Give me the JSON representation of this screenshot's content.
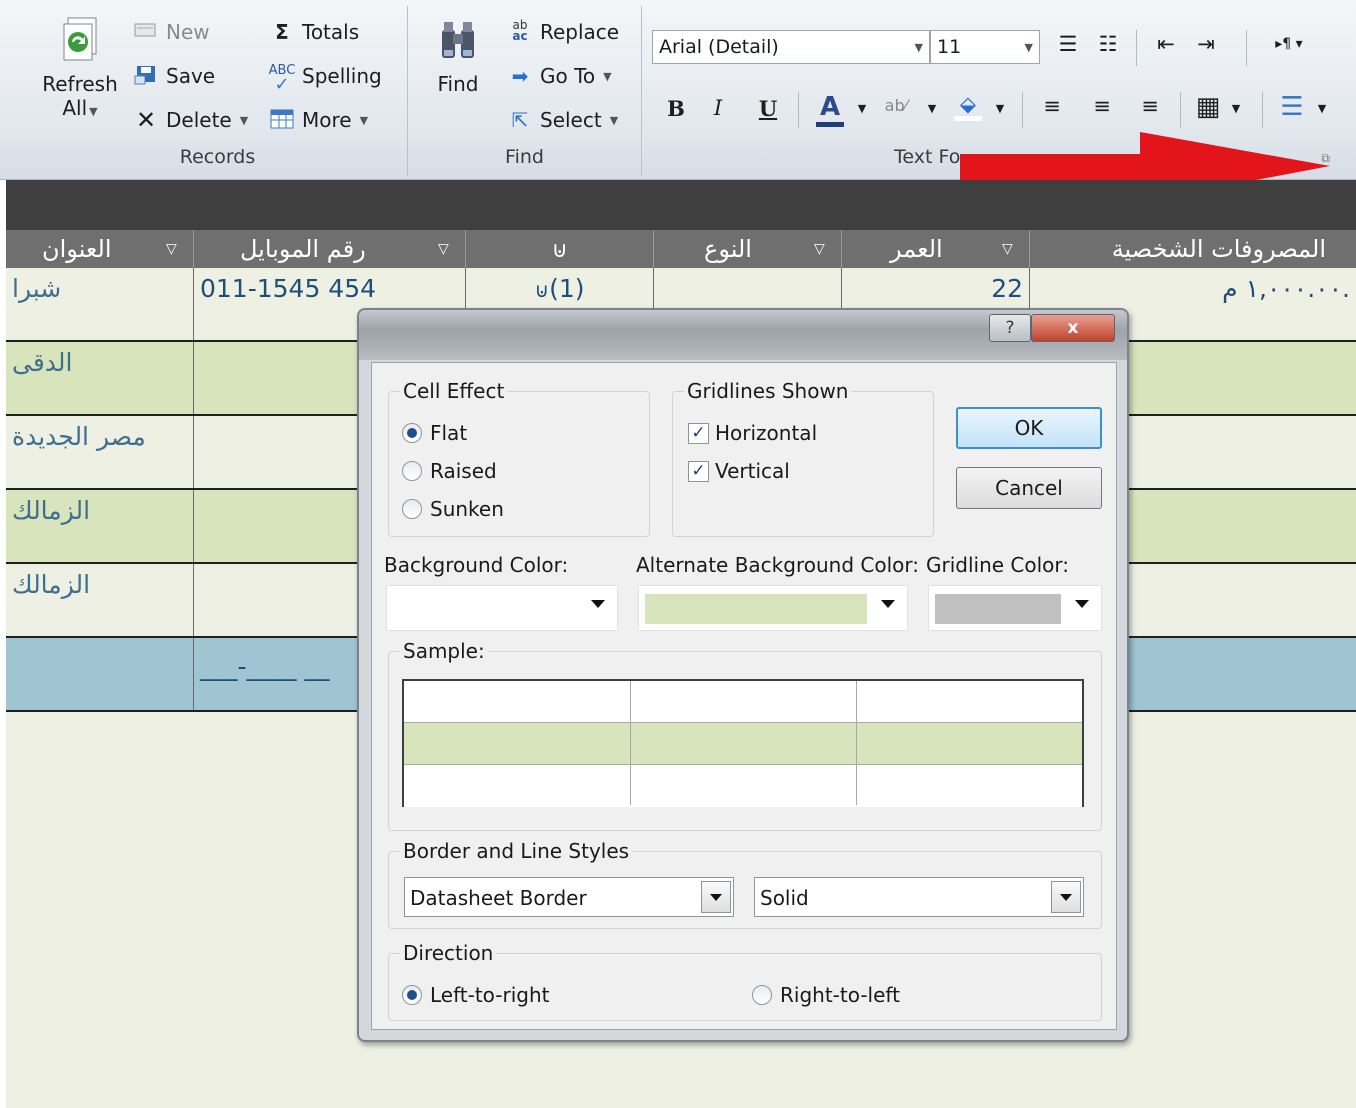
{
  "ribbon": {
    "records": {
      "refresh_label1": "Refresh",
      "refresh_label2": "All",
      "new_label": "New",
      "save_label": "Save",
      "delete_label": "Delete",
      "totals_label": "Totals",
      "spelling_label": "Spelling",
      "more_label": "More",
      "group_label": "Records"
    },
    "find": {
      "find_label": "Find",
      "replace_label": "Replace",
      "goto_label": "Go To",
      "select_label": "Select",
      "group_label": "Find"
    },
    "text_formatting": {
      "font_name": "Arial (Detail)",
      "font_size": "11",
      "bold": "B",
      "italic": "I",
      "underline": "U",
      "font_color": "A",
      "group_label": "Text Fo"
    }
  },
  "datasheet": {
    "headers": [
      "العنوان",
      "رقم الموبايل",
      "",
      "النوع",
      "العمر",
      "المصروفات الشخصية"
    ],
    "rows": [
      {
        "address": "شبرا",
        "mobile": "011-1545 454",
        "attachment": "(1)",
        "type": "",
        "age": "22",
        "expenses": "١,٠٠٠.٠٠ م."
      },
      {
        "address": "الدقى",
        "mobile": "",
        "attachment": "",
        "type": "",
        "age": "",
        "expenses": ""
      },
      {
        "address": "مصر الجديدة",
        "mobile": "",
        "attachment": "",
        "type": "",
        "age": "",
        "expenses": ""
      },
      {
        "address": "الزمالك",
        "mobile": "",
        "attachment": "",
        "type": "",
        "age": "",
        "expenses": ""
      },
      {
        "address": "الزمالك",
        "mobile": "",
        "attachment": "",
        "type": "",
        "age": "",
        "expenses": ""
      }
    ],
    "new_row_mask": "___-____ __"
  },
  "dialog": {
    "help_label": "?",
    "close_label": "x",
    "cell_effect": {
      "title": "Cell Effect",
      "options": [
        "Flat",
        "Raised",
        "Sunken"
      ],
      "selected": "Flat"
    },
    "gridlines": {
      "title": "Gridlines Shown",
      "horizontal_label": "Horizontal",
      "horizontal_checked": true,
      "vertical_label": "Vertical",
      "vertical_checked": true
    },
    "ok_label": "OK",
    "cancel_label": "Cancel",
    "background_color_label": "Background Color:",
    "background_color": "#ffffff",
    "alternate_background_label": "Alternate Background Color:",
    "alternate_background_color": "#d7e4bc",
    "gridline_color_label": "Gridline Color:",
    "gridline_color": "#c0c0c0",
    "sample_label": "Sample:",
    "border_styles": {
      "title": "Border and Line Styles",
      "border_value": "Datasheet Border",
      "line_value": "Solid"
    },
    "direction": {
      "title": "Direction",
      "ltr_label": "Left-to-right",
      "rtl_label": "Right-to-left",
      "selected": "Left-to-right"
    }
  },
  "colors": {
    "accent_red_arrow": "#e4151a",
    "datasheet_header": "#6f6f6f",
    "alt_row": "#d7e4bc",
    "new_row": "#9fc5d2"
  }
}
